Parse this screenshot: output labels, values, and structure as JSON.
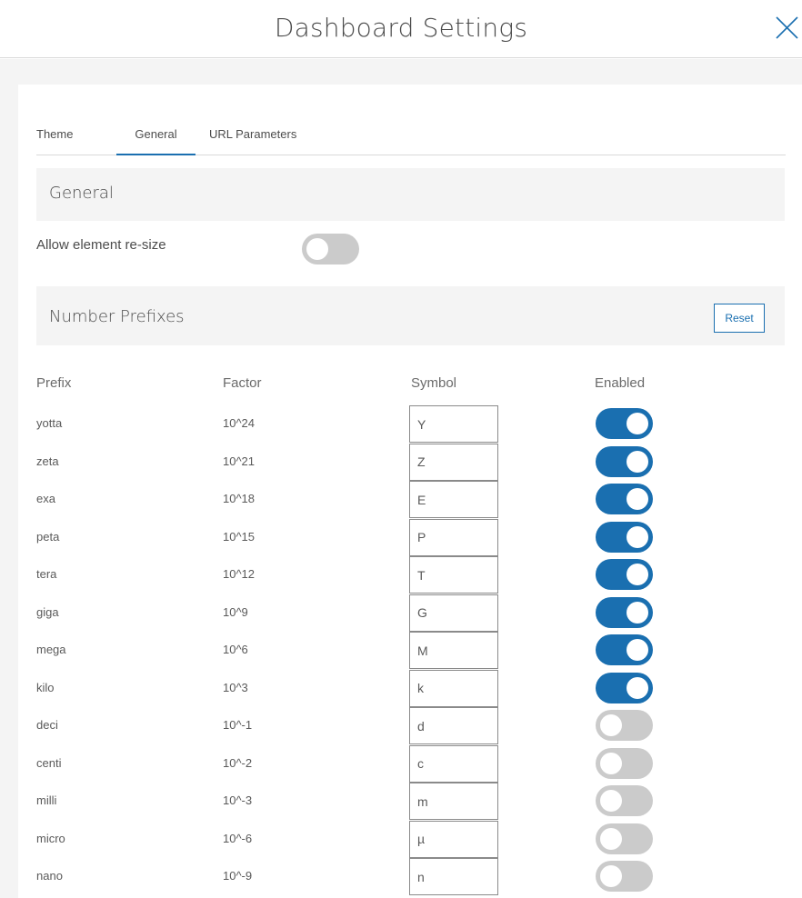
{
  "dialog": {
    "title": "Dashboard Settings",
    "close_icon": "close-icon"
  },
  "tabs": [
    {
      "label": "Theme",
      "active": false
    },
    {
      "label": "General",
      "active": true
    },
    {
      "label": "URL Parameters",
      "active": false
    }
  ],
  "general_section": {
    "title": "General",
    "allow_resize_label": "Allow element re-size",
    "allow_resize_enabled": false
  },
  "prefixes_section": {
    "title": "Number Prefixes",
    "reset_label": "Reset",
    "columns": {
      "prefix": "Prefix",
      "factor": "Factor",
      "symbol": "Symbol",
      "enabled": "Enabled"
    },
    "rows": [
      {
        "prefix": "yotta",
        "factor": "10^24",
        "symbol": "Y",
        "enabled": true
      },
      {
        "prefix": "zeta",
        "factor": "10^21",
        "symbol": "Z",
        "enabled": true
      },
      {
        "prefix": "exa",
        "factor": "10^18",
        "symbol": "E",
        "enabled": true
      },
      {
        "prefix": "peta",
        "factor": "10^15",
        "symbol": "P",
        "enabled": true
      },
      {
        "prefix": "tera",
        "factor": "10^12",
        "symbol": "T",
        "enabled": true
      },
      {
        "prefix": "giga",
        "factor": "10^9",
        "symbol": "G",
        "enabled": true
      },
      {
        "prefix": "mega",
        "factor": "10^6",
        "symbol": "M",
        "enabled": true
      },
      {
        "prefix": "kilo",
        "factor": "10^3",
        "symbol": "k",
        "enabled": true
      },
      {
        "prefix": "deci",
        "factor": "10^-1",
        "symbol": "d",
        "enabled": false
      },
      {
        "prefix": "centi",
        "factor": "10^-2",
        "symbol": "c",
        "enabled": false
      },
      {
        "prefix": "milli",
        "factor": "10^-3",
        "symbol": "m",
        "enabled": false
      },
      {
        "prefix": "micro",
        "factor": "10^-6",
        "symbol": "µ",
        "enabled": false
      },
      {
        "prefix": "nano",
        "factor": "10^-9",
        "symbol": "n",
        "enabled": false
      }
    ]
  },
  "colors": {
    "accent": "#1a6fb0",
    "toggle_off": "#cbcbcb",
    "section_bg": "#f4f4f4"
  }
}
